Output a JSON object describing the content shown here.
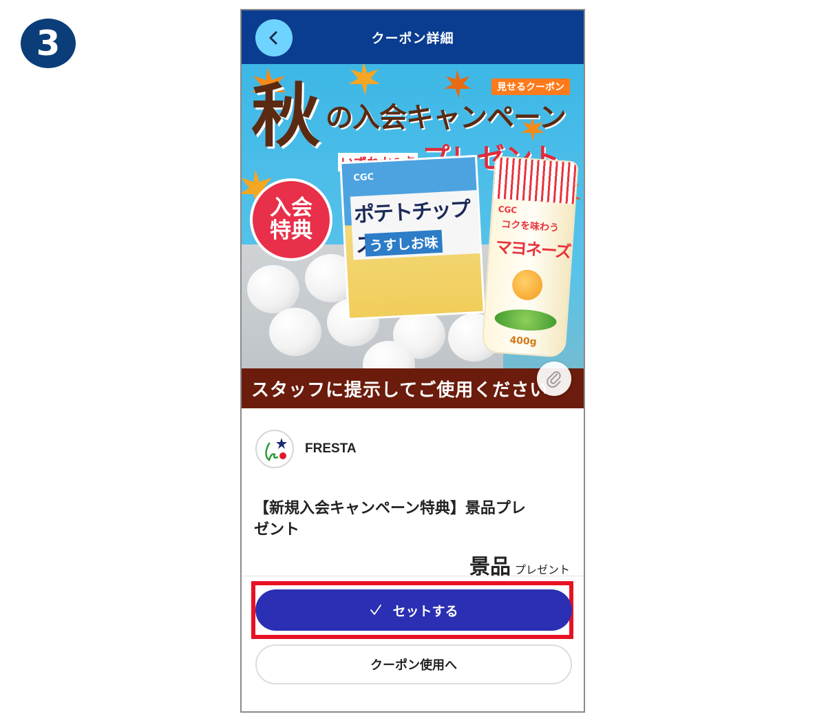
{
  "step": {
    "number": "3"
  },
  "header": {
    "title": "クーポン詳細",
    "back_icon": "chevron-left-icon"
  },
  "banner": {
    "show_badge": "見せるクーポン",
    "aki": "秋",
    "campaign_rest": "の入会キャンペーン",
    "any_one": "いずれか1点",
    "present": "プレゼント",
    "join_benefit_line1": "入会",
    "join_benefit_line2": "特典",
    "chips": {
      "brand": "CGC",
      "name": "ポテトチップス",
      "flavor": "うすしお味"
    },
    "mayo": {
      "brand": "CGC",
      "sub": "コクを味わう",
      "name": "マヨネーズ",
      "weight": "400g"
    },
    "staff_notice": "スタッフに提示してご使用ください",
    "clip_icon": "paperclip-icon"
  },
  "store": {
    "name": "FRESTA",
    "logo_icon": "fresta-logo-icon"
  },
  "coupon": {
    "title": "【新規入会キャンペーン特典】景品プレゼント",
    "prize_big": "景品",
    "prize_small": "プレゼント"
  },
  "actions": {
    "set_label": "セットする",
    "set_icon": "checkmark-icon",
    "use_label": "クーポン使用へ"
  },
  "colors": {
    "header": "#0a3d8f",
    "back_button": "#6fd3ff",
    "set_button": "#2b2fb3",
    "highlight": "#e81123",
    "step_badge": "#0b3d79"
  }
}
